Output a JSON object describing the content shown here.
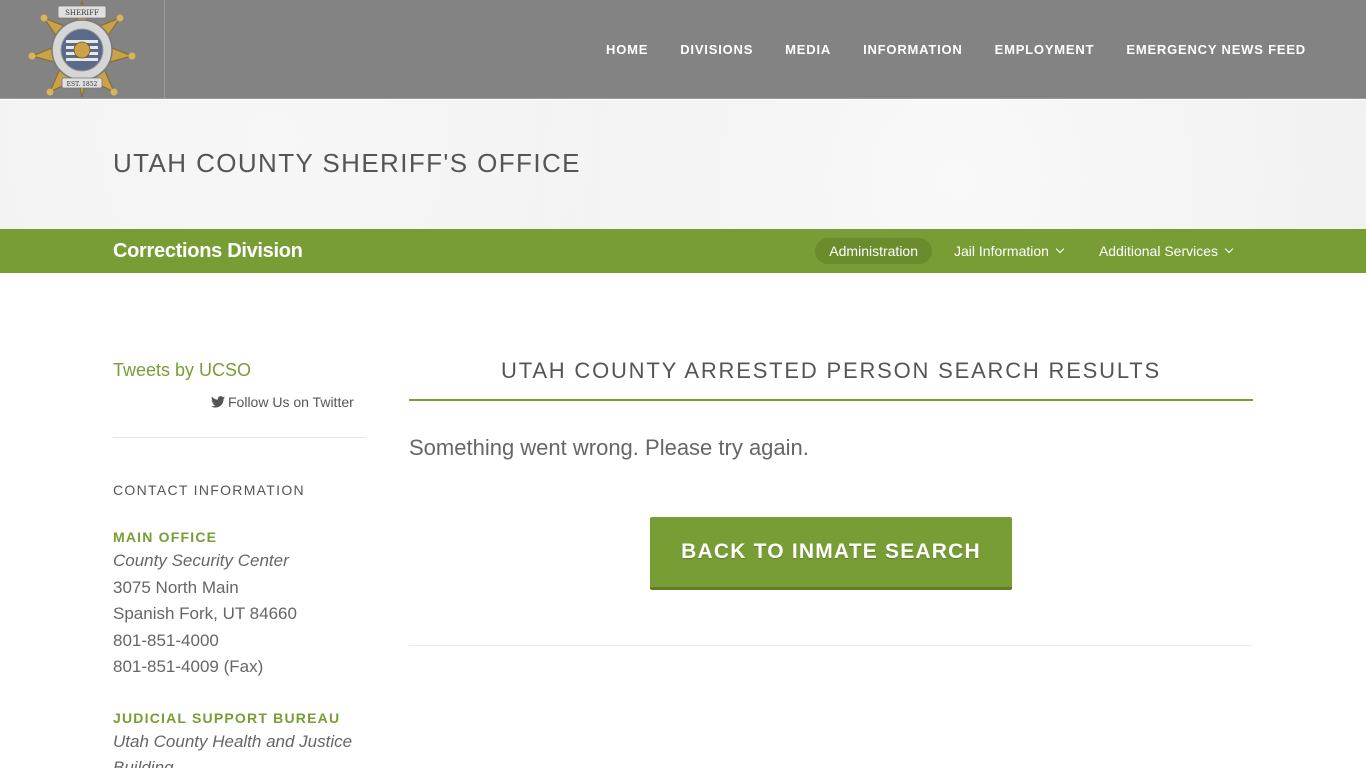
{
  "topnav": {
    "items": [
      "HOME",
      "DIVISIONS",
      "MEDIA",
      "INFORMATION",
      "EMPLOYMENT",
      "EMERGENCY NEWS FEED"
    ]
  },
  "hero": {
    "title": "UTAH COUNTY SHERIFF'S OFFICE"
  },
  "division": {
    "title": "Corrections Division",
    "subnav": [
      {
        "label": "Administration",
        "active": true
      },
      {
        "label": "Jail Information",
        "has_dropdown": true
      },
      {
        "label": "Additional Services",
        "has_dropdown": true
      }
    ]
  },
  "sidebar": {
    "tweets_link": "Tweets by UCSO",
    "follow_label": "Follow Us on Twitter",
    "contact_heading": "CONTACT INFORMATION",
    "main_office": {
      "label": "MAIN OFFICE",
      "name": "County Security Center",
      "street": "3075 North Main",
      "city": "Spanish Fork, UT 84660",
      "phone": "801-851-4000",
      "fax": "801-851-4009 (Fax)"
    },
    "judicial": {
      "label": "JUDICIAL SUPPORT BUREAU",
      "name_line1": "Utah County Health and Justice",
      "name_line2": "Building"
    }
  },
  "main": {
    "title": "UTAH COUNTY ARRESTED PERSON SEARCH RESULTS",
    "error": "Something went wrong. Please try again.",
    "back_button": "BACK TO INMATE SEARCH"
  },
  "logo": {
    "text_top": "SHERIFF",
    "text_ring": "UTAH COUNTY",
    "text_bottom": "SHERIFF'S OFFICE",
    "est": "EST. 1852"
  },
  "colors": {
    "nav_bg": "#838383",
    "accent_green": "#789d35",
    "hero_bg": "#f1f1f1"
  }
}
